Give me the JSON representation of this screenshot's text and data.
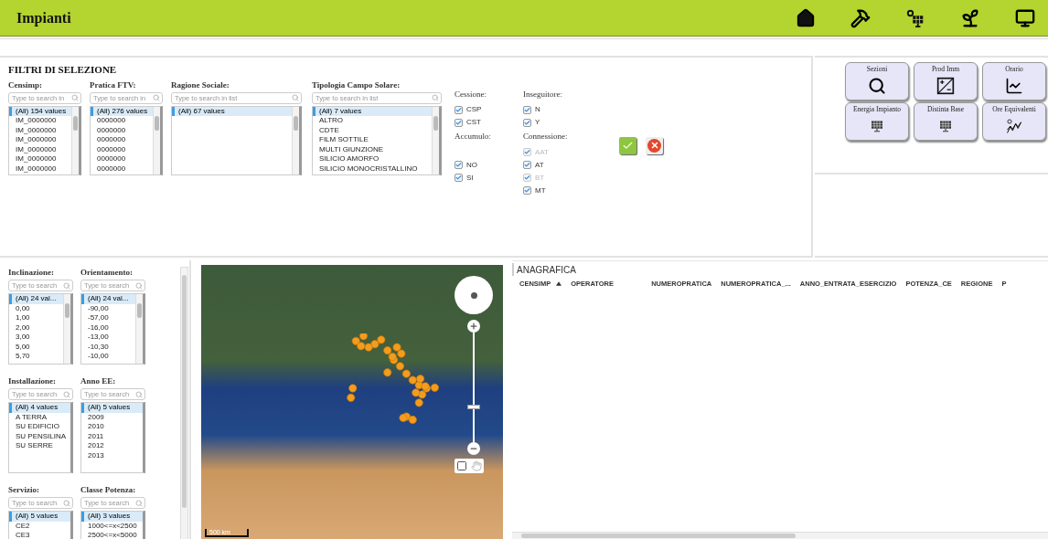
{
  "header": {
    "title": "Impianti"
  },
  "filters": {
    "title": "FILTRI DI SELEZIONE",
    "lists": [
      {
        "label": "Censimp:",
        "placeholder": "Type to search in",
        "items": [
          {
            "text": "(All) 154 values",
            "selected": true
          },
          {
            "text": "IM_0000000",
            "selected": false
          },
          {
            "text": "IM_0000000",
            "selected": false
          },
          {
            "text": "IM_0000000",
            "selected": false
          },
          {
            "text": "IM_0000000",
            "selected": false
          },
          {
            "text": "IM_0000000",
            "selected": false
          },
          {
            "text": "IM_0000000",
            "selected": false
          }
        ]
      },
      {
        "label": "Pratica FTV:",
        "placeholder": "Type to search in",
        "items": [
          {
            "text": "(All) 276 values",
            "selected": true
          },
          {
            "text": "0000000",
            "selected": false
          },
          {
            "text": "0000000",
            "selected": false
          },
          {
            "text": "0000000",
            "selected": false
          },
          {
            "text": "0000000",
            "selected": false
          },
          {
            "text": "0000000",
            "selected": false
          },
          {
            "text": "0000000",
            "selected": false
          }
        ]
      },
      {
        "label": "Ragione Sociale:",
        "placeholder": "Type to search in list",
        "items": [
          {
            "text": "(All) 67 values",
            "selected": true
          }
        ]
      },
      {
        "label": "Tipologia Campo Solare:",
        "placeholder": "Type to search in list",
        "items": [
          {
            "text": "(All) 7 values",
            "selected": true
          },
          {
            "text": "ALTRO",
            "selected": false
          },
          {
            "text": "CDTE",
            "selected": false
          },
          {
            "text": "FILM SOTTILE",
            "selected": false
          },
          {
            "text": "MULTI GIUNZIONE",
            "selected": false
          },
          {
            "text": "SILICIO AMORFO",
            "selected": false
          },
          {
            "text": "SILICIO MONOCRISTALLINO",
            "selected": false
          }
        ]
      }
    ],
    "checkbox_groups": [
      {
        "label": "Cessione:",
        "options": [
          {
            "text": "CSP",
            "checked": true,
            "disabled": false
          },
          {
            "text": "CST",
            "checked": true,
            "disabled": false
          }
        ]
      },
      {
        "label": "Inseguitore:",
        "options": [
          {
            "text": "N",
            "checked": true,
            "disabled": false
          },
          {
            "text": "Y",
            "checked": true,
            "disabled": false
          }
        ]
      },
      {
        "label": "Accumulo:",
        "options": [
          {
            "text": "NO",
            "checked": true,
            "disabled": false
          },
          {
            "text": "SI",
            "checked": true,
            "disabled": false
          }
        ]
      },
      {
        "label": "Connessione:",
        "options": [
          {
            "text": "AAT",
            "checked": true,
            "disabled": true
          },
          {
            "text": "AT",
            "checked": true,
            "disabled": false
          },
          {
            "text": "BT",
            "checked": true,
            "disabled": true
          },
          {
            "text": "MT",
            "checked": true,
            "disabled": false
          }
        ]
      }
    ]
  },
  "action_buttons": [
    {
      "label": "Sezioni",
      "kind": "search"
    },
    {
      "label": "Prod Imm",
      "kind": "converter"
    },
    {
      "label": "Orario",
      "kind": "curve"
    },
    {
      "label": "Energia Impianto",
      "kind": "panel"
    },
    {
      "label": "Distinta Base",
      "kind": "panel-list"
    },
    {
      "label": "Ore Equivalenti",
      "kind": "sun-chart"
    }
  ],
  "side_filters": [
    {
      "label": "Inclinazione:",
      "placeholder": "Type to search",
      "items": [
        {
          "text": "(All) 24 val...",
          "selected": true
        },
        {
          "text": "0,00",
          "selected": false
        },
        {
          "text": "1,00",
          "selected": false
        },
        {
          "text": "2,00",
          "selected": false
        },
        {
          "text": "3,00",
          "selected": false
        },
        {
          "text": "5,00",
          "selected": false
        },
        {
          "text": "5,70",
          "selected": false
        }
      ]
    },
    {
      "label": "Orientamento:",
      "placeholder": "Type to search",
      "items": [
        {
          "text": "(All) 24 val...",
          "selected": true
        },
        {
          "text": "-90,00",
          "selected": false
        },
        {
          "text": "-57,00",
          "selected": false
        },
        {
          "text": "-16,00",
          "selected": false
        },
        {
          "text": "-13,00",
          "selected": false
        },
        {
          "text": "-10,30",
          "selected": false
        },
        {
          "text": "-10,00",
          "selected": false
        }
      ]
    },
    {
      "label": "Installazione:",
      "placeholder": "Type to search",
      "items": [
        {
          "text": "(All) 4 values",
          "selected": true
        },
        {
          "text": "A TERRA",
          "selected": false
        },
        {
          "text": "SU EDIFICIO",
          "selected": false
        },
        {
          "text": "SU PENSILINA",
          "selected": false
        },
        {
          "text": "SU SERRE",
          "selected": false
        }
      ]
    },
    {
      "label": "Anno EE:",
      "placeholder": "Type to search",
      "items": [
        {
          "text": "(All) 5 values",
          "selected": true
        },
        {
          "text": "2009",
          "selected": false
        },
        {
          "text": "2010",
          "selected": false
        },
        {
          "text": "2011",
          "selected": false
        },
        {
          "text": "2012",
          "selected": false
        },
        {
          "text": "2013",
          "selected": false
        }
      ]
    },
    {
      "label": "Servizio:",
      "placeholder": "Type to search",
      "items": [
        {
          "text": "(All) 5 values",
          "selected": true
        },
        {
          "text": "CE2",
          "selected": false
        },
        {
          "text": "CE3",
          "selected": false
        }
      ]
    },
    {
      "label": "Classe Potenza:",
      "placeholder": "Type to search",
      "items": [
        {
          "text": "(All) 3 values",
          "selected": true
        },
        {
          "text": "1000<=x<2500",
          "selected": false
        },
        {
          "text": "2500<=x<5000",
          "selected": false
        }
      ]
    }
  ],
  "map": {
    "scale": "500 km",
    "zoom": {
      "level": 0.3
    }
  },
  "table": {
    "title": "ANAGRAFICA",
    "columns": [
      {
        "label": "CENSIMP",
        "sorted": true
      },
      {
        "label": "OPERATORE",
        "sorted": false
      },
      {
        "label": "NUMEROPRATICA",
        "sorted": false
      },
      {
        "label": "NUMEROPRATICA_...",
        "sorted": false
      },
      {
        "label": "ANNO_ENTRATA_ESERCIZIO",
        "sorted": false
      },
      {
        "label": "POTENZA_CE",
        "sorted": false
      },
      {
        "label": "REGIONE",
        "sorted": false
      },
      {
        "label": "P",
        "sorted": false
      }
    ]
  }
}
